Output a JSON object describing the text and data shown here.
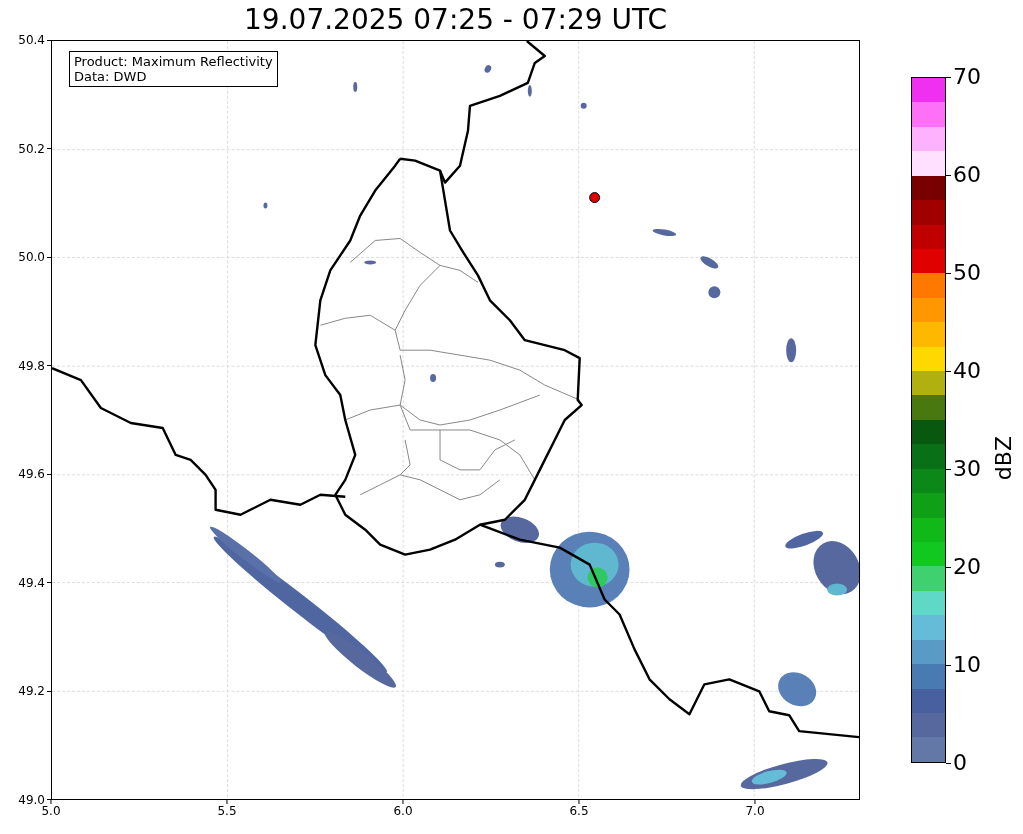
{
  "title": "19.07.2025 07:25 - 07:29 UTC",
  "legend": {
    "lines": [
      "Product: Maximum Reflectivity",
      "Data: DWD"
    ]
  },
  "y_axis": {
    "ticks": [
      "50.4",
      "50.2",
      "50.0",
      "49.8",
      "49.6",
      "49.4",
      "49.2",
      "49.0"
    ]
  },
  "x_axis": {
    "ticks": [
      "5.0",
      "5.5",
      "6.0",
      "6.5",
      "7.0"
    ]
  },
  "colorbar": {
    "ticks": [
      "70",
      "60",
      "50",
      "40",
      "30",
      "20",
      "10",
      "0"
    ],
    "label": "dBZ",
    "segments": [
      {
        "color": "#f030f0"
      },
      {
        "color": "#ff70f8"
      },
      {
        "color": "#ffb0ff"
      },
      {
        "color": "#ffe0ff"
      },
      {
        "color": "#780000"
      },
      {
        "color": "#a00000"
      },
      {
        "color": "#c00000"
      },
      {
        "color": "#e00000"
      },
      {
        "color": "#ff7800"
      },
      {
        "color": "#ff9800"
      },
      {
        "color": "#ffb800"
      },
      {
        "color": "#ffd800"
      },
      {
        "color": "#b0b010"
      },
      {
        "color": "#4a7810"
      },
      {
        "color": "#085810"
      },
      {
        "color": "#0a7018"
      },
      {
        "color": "#0c8818"
      },
      {
        "color": "#10a018"
      },
      {
        "color": "#10b818"
      },
      {
        "color": "#10c820"
      },
      {
        "color": "#40d070"
      },
      {
        "color": "#5fd8c8"
      },
      {
        "color": "#64bcd8"
      },
      {
        "color": "#5a9ac6"
      },
      {
        "color": "#4a7ab2"
      },
      {
        "color": "#4760a0"
      },
      {
        "color": "#56689e"
      },
      {
        "color": "#6478a8"
      }
    ]
  }
}
